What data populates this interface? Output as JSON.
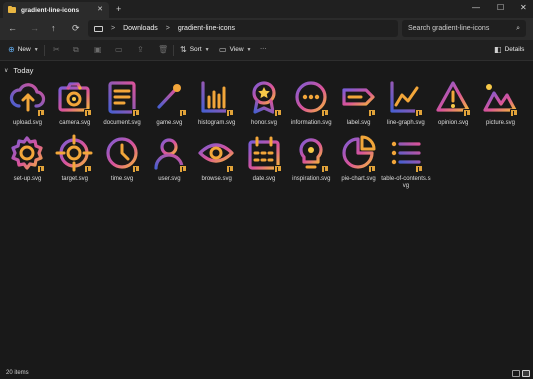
{
  "window": {
    "tab_title": "gradient-line-icons",
    "tab_close": "✕",
    "new_tab": "+",
    "minimize": "—",
    "maximize": "☐",
    "close": "✕"
  },
  "address": {
    "back": "←",
    "forward": "→",
    "up": "↑",
    "refresh": "⟳",
    "separator": ">",
    "breadcrumbs": [
      "Downloads",
      "gradient-line-icons"
    ],
    "search_placeholder": "Search gradient-line-icons",
    "search_icon": "⌕"
  },
  "commands": {
    "new_label": "New",
    "sort_label": "Sort",
    "view_label": "View",
    "more_label": "···",
    "details_label": "Details"
  },
  "group": {
    "label": "Today"
  },
  "files": [
    {
      "name": "upload.svg",
      "icon": "upload"
    },
    {
      "name": "camera.svg",
      "icon": "camera"
    },
    {
      "name": "document.svg",
      "icon": "document"
    },
    {
      "name": "game.svg",
      "icon": "game"
    },
    {
      "name": "histogram.svg",
      "icon": "histogram"
    },
    {
      "name": "honor.svg",
      "icon": "honor"
    },
    {
      "name": "information.svg",
      "icon": "information"
    },
    {
      "name": "label.svg",
      "icon": "label"
    },
    {
      "name": "line-graph.svg",
      "icon": "line-graph"
    },
    {
      "name": "opinion.svg",
      "icon": "opinion"
    },
    {
      "name": "picture.svg",
      "icon": "picture"
    },
    {
      "name": "set-up.svg",
      "icon": "set-up"
    },
    {
      "name": "target.svg",
      "icon": "target"
    },
    {
      "name": "time.svg",
      "icon": "time"
    },
    {
      "name": "user.svg",
      "icon": "user"
    },
    {
      "name": "browse.svg",
      "icon": "browse"
    },
    {
      "name": "date.svg",
      "icon": "date"
    },
    {
      "name": "inspiration.svg",
      "icon": "inspiration"
    },
    {
      "name": "pie-chart.svg",
      "icon": "pie-chart"
    },
    {
      "name": "table-of-contents.svg",
      "icon": "table-of-contents"
    }
  ],
  "status": {
    "item_count": "20 items"
  },
  "colors": {
    "grad_start": "#7b5cd6",
    "grad_mid": "#d9539a",
    "grad_end": "#f5b63b",
    "blue": "#4a5fd0",
    "orange": "#f2a63a",
    "yellow": "#f7c948"
  }
}
